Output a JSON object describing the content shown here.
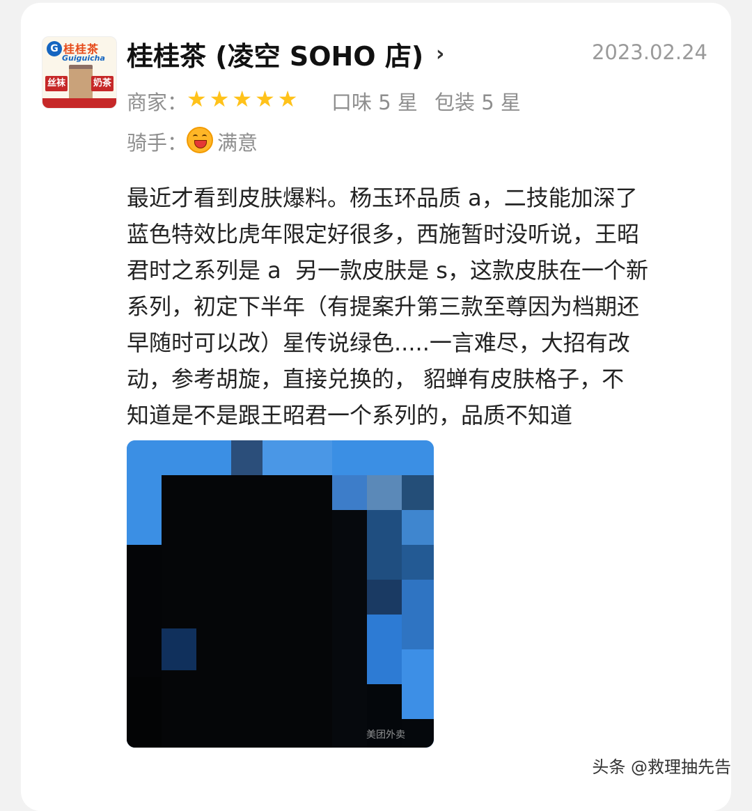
{
  "store": {
    "logo_brand": "桂桂茶",
    "logo_brand_en": "Guiguicha",
    "logo_left_tag": "丝袜",
    "logo_right_tag": "奶茶",
    "name": "桂桂茶 (凌空 SOHO 店)",
    "date": "2023.02.24"
  },
  "ratings": {
    "merchant_label": "商家：",
    "merchant_stars": 5,
    "taste": "口味 5 星",
    "packaging": "包装 5 星",
    "rider_label": "骑手：",
    "rider_value": "满意",
    "rider_icon": "laughing-face-icon",
    "star_color": "#ffc21a"
  },
  "review": {
    "text": "最近才看到皮肤爆料。杨玉环品质 a，二技能加深了\n蓝色特效比虎年限定好很多，西施暂时没听说，王昭\n君时之系列是 a  另一款皮肤是 s，这款皮肤在一个新\n系列，初定下半年（有提案升第三款至尊因为档期还\n早随时可以改）星传说绿色.....一言难尽，大招有改\n动，参考胡旋，直接兑换的， 貂蝉有皮肤格子，不\n知道是不是跟王昭君一个系列的，品质不知道"
  },
  "photo": {
    "watermark": "美团外卖"
  },
  "footer": {
    "source_mark": "头条 @救理抽先告"
  }
}
